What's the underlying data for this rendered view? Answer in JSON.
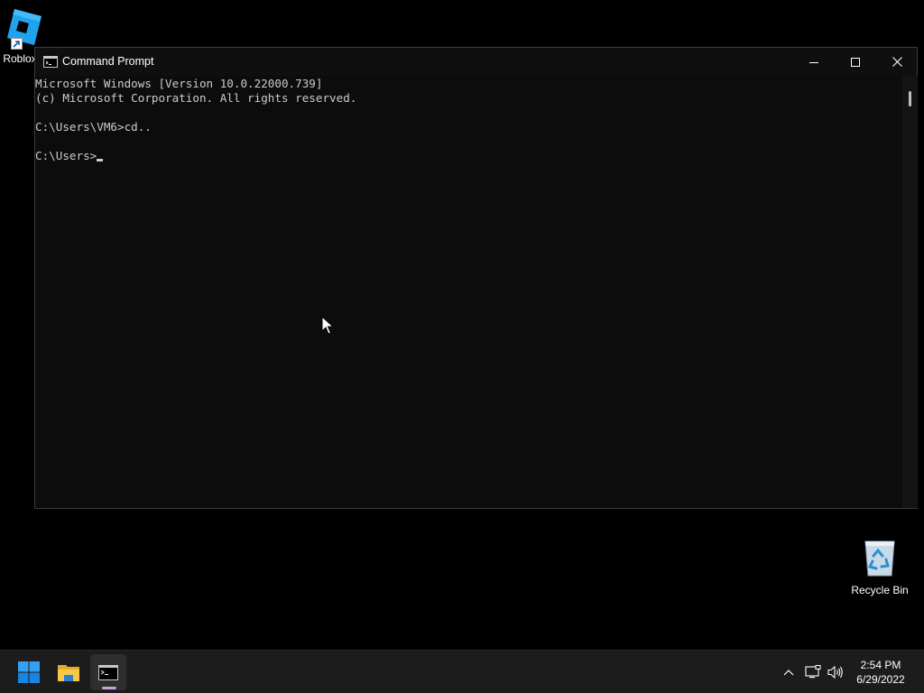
{
  "desktop": {
    "icons": [
      {
        "label": "Roblox",
        "icon": "roblox-icon"
      },
      {
        "label": "Recycle Bin",
        "icon": "recycle-bin-icon"
      }
    ]
  },
  "window": {
    "title": "Command Prompt",
    "icon": "command-prompt-icon",
    "controls": [
      "minimize",
      "maximize",
      "close"
    ]
  },
  "console": {
    "lines": [
      "Microsoft Windows [Version 10.0.22000.739]",
      "(c) Microsoft Corporation. All rights reserved.",
      "",
      "C:\\Users\\VM6>cd..",
      "",
      "C:\\Users>"
    ],
    "text_color": "#cccccc",
    "background": "#0c0c0c"
  },
  "taskbar": {
    "apps": [
      "start-icon",
      "file-explorer-icon",
      "command-prompt-icon"
    ],
    "active_app": "Command Prompt",
    "accent": "#c9a0dc",
    "clock": {
      "time": "2:54 PM",
      "date": "6/29/2022"
    }
  }
}
